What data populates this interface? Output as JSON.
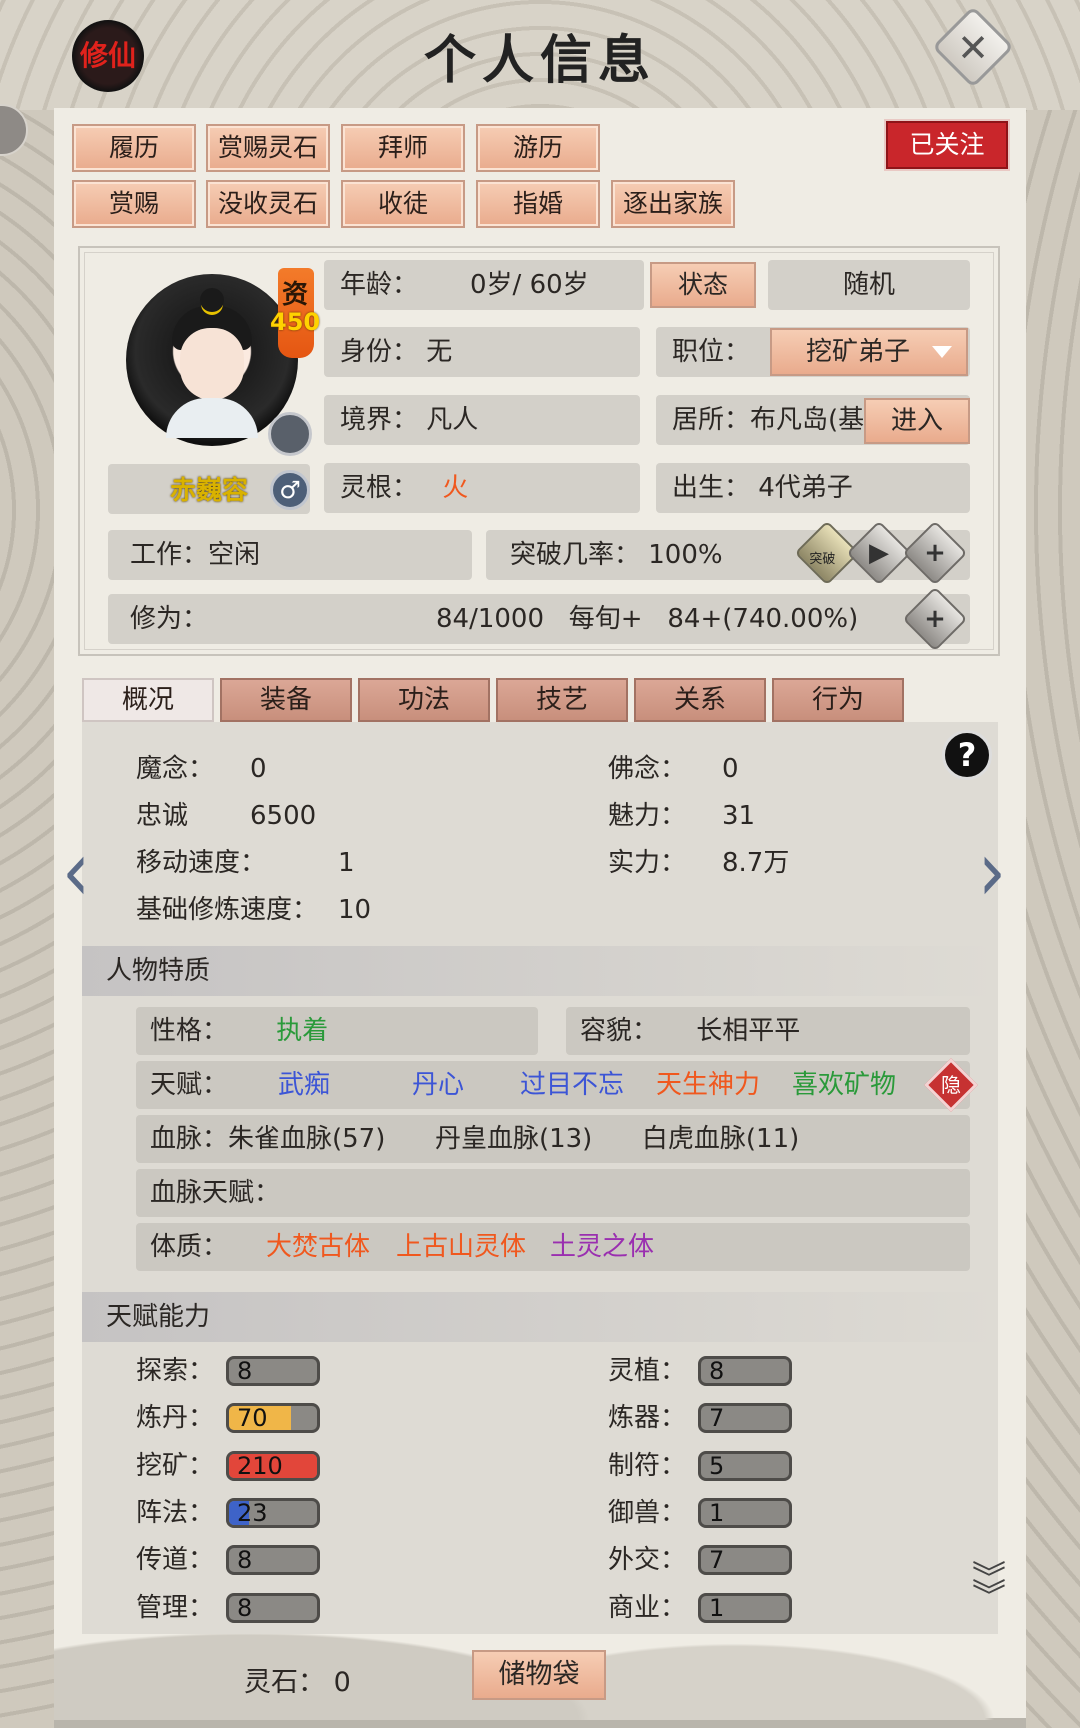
{
  "header": {
    "title": "个人信息",
    "badge": "修仙",
    "close_glyph": "✕"
  },
  "actions": {
    "row1": [
      "履历",
      "赏赐灵石",
      "拜师",
      "游历"
    ],
    "row2": [
      "赏赐",
      "没收灵石",
      "收徒",
      "指婚",
      "逐出家族"
    ],
    "followed": "已关注"
  },
  "profile": {
    "zi_label": "资",
    "zi_value": "450",
    "name": "赤巍容",
    "gender_icon": "♂",
    "age": "年龄：",
    "age_value": "0岁/ 60岁",
    "state_button": "状态",
    "random_button": "随机",
    "identity": "身份：  无",
    "position_label": "职位：",
    "position_value": "挖矿弟子",
    "realm": "境界：  凡人",
    "residence": "居所：布凡岛(基",
    "enter_button": "进入",
    "root_label": "灵根：",
    "root_value": "火",
    "birth": "出生：  4代弟子",
    "work": "工作：空闲",
    "breakthrough": "突破几率：  100%",
    "breakthrough_icon_text": "突破",
    "cultivation_label": "修为：",
    "cultivation_value": "84/1000   每旬+   84+(740.00%)"
  },
  "tabs": [
    "概况",
    "装备",
    "功法",
    "技艺",
    "关系",
    "行为"
  ],
  "stats": {
    "left": [
      {
        "label": "魔念：",
        "value": "0"
      },
      {
        "label": "忠诚",
        "value": "6500"
      },
      {
        "label": "移动速度：",
        "value": "1"
      },
      {
        "label": "基础修炼速度：",
        "value": "10"
      }
    ],
    "right": [
      {
        "label": "佛念：",
        "value": "0"
      },
      {
        "label": "魅力：",
        "value": "31"
      },
      {
        "label": "实力：",
        "value": "8.7万"
      }
    ]
  },
  "traits": {
    "section_title": "人物特质",
    "personality_label": "性格：",
    "personality_value": "执着",
    "looks_label": "容貌：",
    "looks_value": "长相平平",
    "talent_label": "天赋：",
    "talents": [
      {
        "text": "武痴",
        "color": "#3c55d6"
      },
      {
        "text": "丹心",
        "color": "#3c55d6"
      },
      {
        "text": "过目不忘",
        "color": "#3c55d6"
      },
      {
        "text": "天生神力",
        "color": "#f0581e"
      },
      {
        "text": "喜欢矿物",
        "color": "#2a9a3a"
      }
    ],
    "hide_button": "隐",
    "bloodline": "血脉：朱雀血脉(57)      丹皇血脉(13)      白虎血脉(11)",
    "bloodline_talent": "血脉天赋：",
    "constitution_label": "体质：",
    "constitutions": [
      {
        "text": "大焚古体",
        "color": "#f0581e"
      },
      {
        "text": "上古山灵体",
        "color": "#f0581e"
      },
      {
        "text": "土灵之体",
        "color": "#9a2fb0"
      }
    ]
  },
  "abilities": {
    "section_title": "天赋能力",
    "left": [
      {
        "label": "探索：",
        "value": "8",
        "fill": 0.0,
        "color": "#8b8985"
      },
      {
        "label": "炼丹：",
        "value": "70",
        "fill": 0.7,
        "color": "#f0b648"
      },
      {
        "label": "挖矿：",
        "value": "210",
        "fill": 1.0,
        "color": "#e2463a"
      },
      {
        "label": "阵法：",
        "value": "23",
        "fill": 0.23,
        "color": "#3e63c8"
      },
      {
        "label": "传道：",
        "value": "8",
        "fill": 0.0,
        "color": "#8b8985"
      },
      {
        "label": "管理：",
        "value": "8",
        "fill": 0.0,
        "color": "#8b8985"
      }
    ],
    "right": [
      {
        "label": "灵植：",
        "value": "8"
      },
      {
        "label": "炼器：",
        "value": "7"
      },
      {
        "label": "制符：",
        "value": "5"
      },
      {
        "label": "御兽：",
        "value": "1"
      },
      {
        "label": "外交：",
        "value": "7"
      },
      {
        "label": "商业：",
        "value": "1"
      }
    ]
  },
  "footer": {
    "spirit_stones": "灵石：  0",
    "bag_button": "储物袋"
  },
  "colors": {
    "root_fire": "#f0581e",
    "personality": "#2a9a3a"
  }
}
